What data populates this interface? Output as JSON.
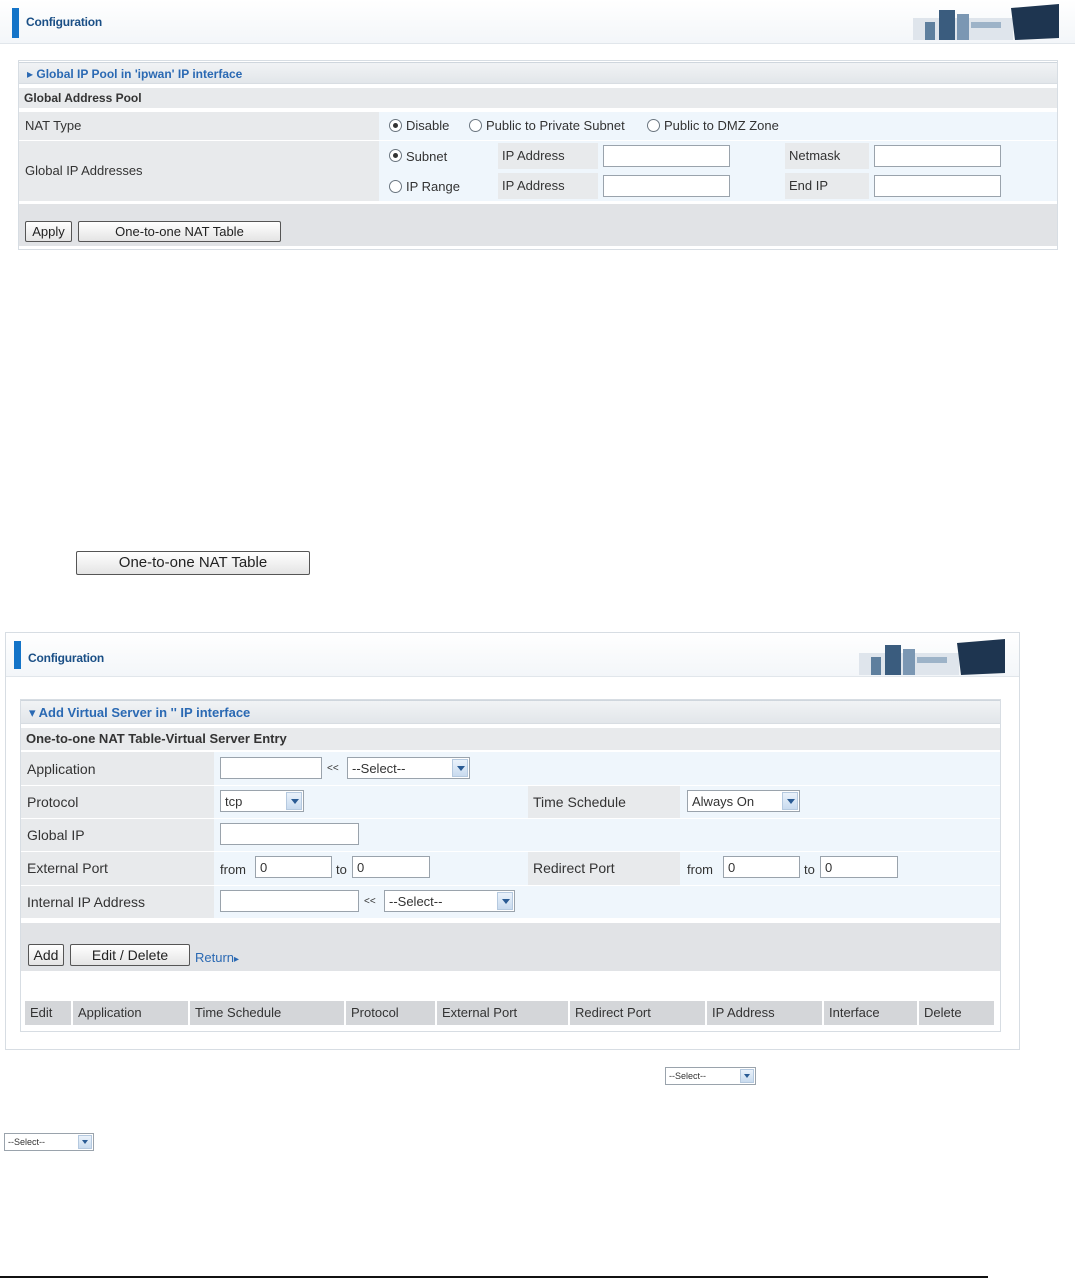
{
  "panel1": {
    "header_title": "Configuration",
    "section_title": "Global IP Pool in 'ipwan' IP interface",
    "subsection_title": "Global Address Pool",
    "nat_type": {
      "label": "NAT Type",
      "options": [
        "Disable",
        "Public to Private Subnet",
        "Public to DMZ Zone"
      ],
      "selected": "Disable"
    },
    "global_ip": {
      "label": "Global IP Addresses",
      "subnet": {
        "label": "Subnet",
        "ip_label": "IP Address",
        "ip_value": "",
        "mask_label": "Netmask",
        "mask_value": ""
      },
      "range": {
        "label": "IP Range",
        "ip_label": "IP Address",
        "ip_value": "",
        "end_label": "End IP",
        "end_value": ""
      }
    },
    "buttons": {
      "apply": "Apply",
      "nat_table": "One-to-one NAT Table"
    }
  },
  "standalone_button": "One-to-one NAT Table",
  "panel2": {
    "header_title": "Configuration",
    "section_title": "Add Virtual Server in '' IP interface",
    "subsection_title": "One-to-one NAT Table-Virtual Server Entry",
    "application": {
      "label": "Application",
      "value": "",
      "arrows": "<<",
      "select": "--Select--"
    },
    "protocol": {
      "label": "Protocol",
      "select": "tcp"
    },
    "time_schedule": {
      "label": "Time Schedule",
      "select": "Always On"
    },
    "global_ip": {
      "label": "Global IP",
      "value": ""
    },
    "external_port": {
      "label": "External Port",
      "from_label": "from",
      "from_value": "0",
      "to_label": "to",
      "to_value": "0"
    },
    "redirect_port": {
      "label": "Redirect Port",
      "from_label": "from",
      "from_value": "0",
      "to_label": "to",
      "to_value": "0"
    },
    "internal_ip": {
      "label": "Internal IP Address",
      "value": "",
      "arrows": "<<",
      "select": "--Select--"
    },
    "buttons": {
      "add": "Add",
      "edit_delete": "Edit / Delete",
      "return": "Return"
    },
    "table_headers": [
      "Edit",
      "Application",
      "Time Schedule",
      "Protocol",
      "External Port",
      "Redirect Port",
      "IP Address",
      "Interface",
      "Delete"
    ]
  },
  "mini_selects": [
    "--Select--",
    "--Select--"
  ],
  "colors": {
    "accent": "#1474c8",
    "link": "#2a69b3",
    "row_bg": "#eff6fc",
    "label_bg": "#e8eaec"
  }
}
